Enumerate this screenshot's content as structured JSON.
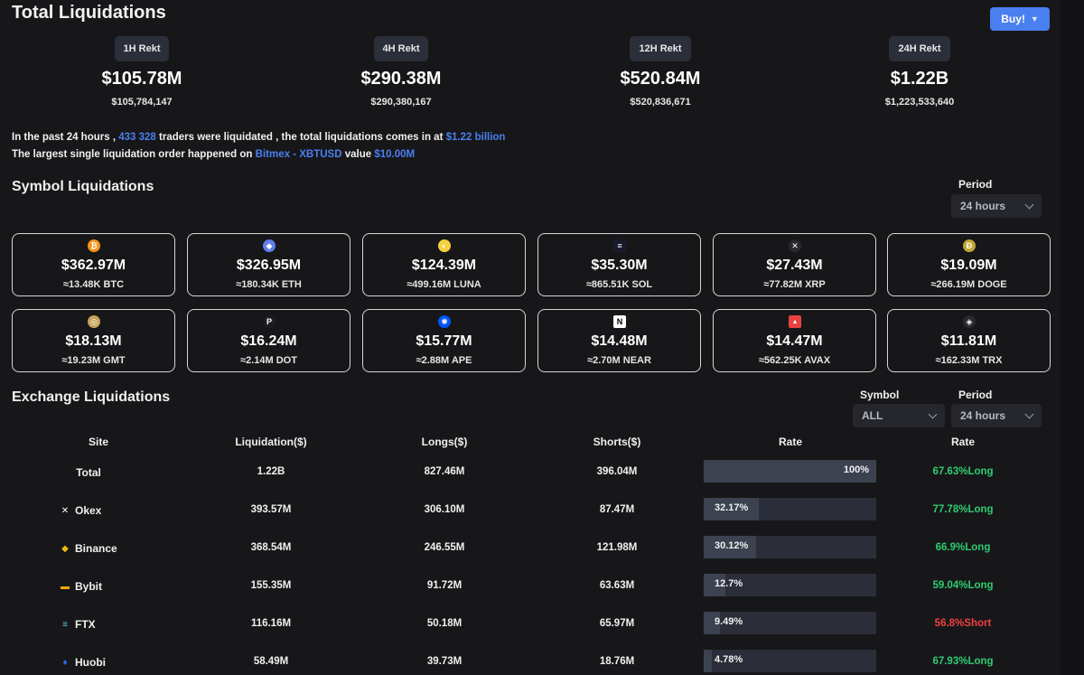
{
  "header": {
    "title": "Total Liquidations",
    "buy_label": "Buy!"
  },
  "rekt": [
    {
      "label": "1H Rekt",
      "short": "$105.78M",
      "full": "$105,784,147"
    },
    {
      "label": "4H Rekt",
      "short": "$290.38M",
      "full": "$290,380,167"
    },
    {
      "label": "12H Rekt",
      "short": "$520.84M",
      "full": "$520,836,671"
    },
    {
      "label": "24H Rekt",
      "short": "$1.22B",
      "full": "$1,223,533,640"
    }
  ],
  "summary": {
    "line1_pre": "In the past 24 hours ,",
    "traders": "433 328",
    "line1_mid": "traders were liquidated , the total liquidations comes in at",
    "total": "$1.22 billion",
    "line2_pre": "The largest single liquidation order happened on",
    "exchange": "Bitmex - XBTUSD",
    "line2_mid": "value",
    "value": "$10.00M"
  },
  "symbol_section": {
    "title": "Symbol Liquidations",
    "period_label": "Period",
    "period_value": "24 hours"
  },
  "coins": [
    {
      "usd": "$362.97M",
      "amt": "≈13.48K BTC",
      "icon": "btc-icon",
      "color": "#f7931a",
      "glyph": "₿"
    },
    {
      "usd": "$326.95M",
      "amt": "≈180.34K ETH",
      "icon": "eth-icon",
      "color": "#627eea",
      "glyph": "◆"
    },
    {
      "usd": "$124.39M",
      "amt": "≈499.16M LUNA",
      "icon": "luna-icon",
      "color": "#f4d03f",
      "glyph": "◐"
    },
    {
      "usd": "$35.30M",
      "amt": "≈865.51K SOL",
      "icon": "sol-icon",
      "color": "#1a1a2e",
      "glyph": "≡"
    },
    {
      "usd": "$27.43M",
      "amt": "≈77.82M XRP",
      "icon": "xrp-icon",
      "color": "#2a2a2e",
      "glyph": "✕"
    },
    {
      "usd": "$19.09M",
      "amt": "≈266.19M DOGE",
      "icon": "doge-icon",
      "color": "#c2a633",
      "glyph": "Ð"
    },
    {
      "usd": "$18.13M",
      "amt": "≈19.23M GMT",
      "icon": "gmt-icon",
      "color": "#c8a25a",
      "glyph": "◎"
    },
    {
      "usd": "$16.24M",
      "amt": "≈2.14M DOT",
      "icon": "dot-icon",
      "color": "#1e1e22",
      "glyph": "P"
    },
    {
      "usd": "$15.77M",
      "amt": "≈2.88M APE",
      "icon": "ape-icon",
      "color": "#0054f9",
      "glyph": "✺"
    },
    {
      "usd": "$14.48M",
      "amt": "≈2.70M NEAR",
      "icon": "near-icon",
      "color": "#ffffff",
      "glyph": "N"
    },
    {
      "usd": "$14.47M",
      "amt": "≈562.25K AVAX",
      "icon": "avax-icon",
      "color": "#e84142",
      "glyph": "▲"
    },
    {
      "usd": "$11.81M",
      "amt": "≈162.33M TRX",
      "icon": "trx-icon",
      "color": "#2a2a2e",
      "glyph": "◈"
    }
  ],
  "exchange_section": {
    "title": "Exchange Liquidations",
    "symbol_label": "Symbol",
    "symbol_value": "ALL",
    "period_label": "Period",
    "period_value": "24 hours"
  },
  "table": {
    "headers": [
      "Site",
      "Liquidation($)",
      "Longs($)",
      "Shorts($)",
      "Rate",
      "Rate"
    ],
    "rows": [
      {
        "site": "Total",
        "icon": "",
        "liq": "1.22B",
        "longs": "827.46M",
        "shorts": "396.04M",
        "share": "100%",
        "share_frac": 1.0,
        "rate": "67.63%Long",
        "dir": "long"
      },
      {
        "site": "Okex",
        "icon": "okex-icon",
        "liq": "393.57M",
        "longs": "306.10M",
        "shorts": "87.47M",
        "share": "32.17%",
        "share_frac": 0.3217,
        "rate": "77.78%Long",
        "dir": "long"
      },
      {
        "site": "Binance",
        "icon": "binance-icon",
        "liq": "368.54M",
        "longs": "246.55M",
        "shorts": "121.98M",
        "share": "30.12%",
        "share_frac": 0.3012,
        "rate": "66.9%Long",
        "dir": "long"
      },
      {
        "site": "Bybit",
        "icon": "bybit-icon",
        "liq": "155.35M",
        "longs": "91.72M",
        "shorts": "63.63M",
        "share": "12.7%",
        "share_frac": 0.127,
        "rate": "59.04%Long",
        "dir": "long"
      },
      {
        "site": "FTX",
        "icon": "ftx-icon",
        "liq": "116.16M",
        "longs": "50.18M",
        "shorts": "65.97M",
        "share": "9.49%",
        "share_frac": 0.0949,
        "rate": "56.8%Short",
        "dir": "short"
      },
      {
        "site": "Huobi",
        "icon": "huobi-icon",
        "liq": "58.49M",
        "longs": "39.73M",
        "shorts": "18.76M",
        "share": "4.78%",
        "share_frac": 0.0478,
        "rate": "67.93%Long",
        "dir": "long"
      }
    ]
  }
}
